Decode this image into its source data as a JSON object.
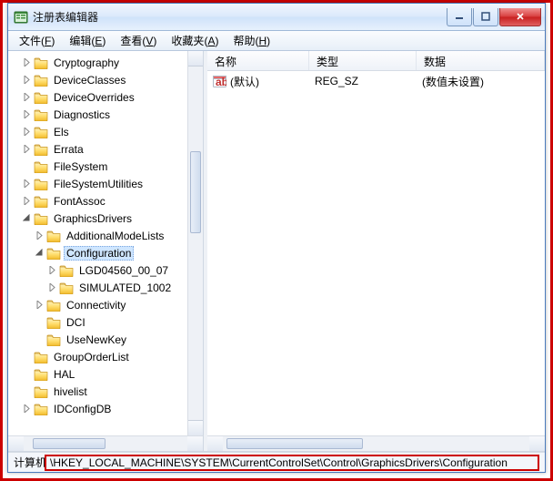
{
  "window": {
    "title": "注册表编辑器"
  },
  "menu": {
    "file": {
      "label": "文件",
      "hotkey": "F"
    },
    "edit": {
      "label": "编辑",
      "hotkey": "E"
    },
    "view": {
      "label": "查看",
      "hotkey": "V"
    },
    "fav": {
      "label": "收藏夹",
      "hotkey": "A"
    },
    "help": {
      "label": "帮助",
      "hotkey": "H"
    }
  },
  "tree": [
    {
      "label": "Cryptography",
      "depth": 0,
      "exp": "closed",
      "selected": false
    },
    {
      "label": "DeviceClasses",
      "depth": 0,
      "exp": "closed",
      "selected": false
    },
    {
      "label": "DeviceOverrides",
      "depth": 0,
      "exp": "closed",
      "selected": false
    },
    {
      "label": "Diagnostics",
      "depth": 0,
      "exp": "closed",
      "selected": false
    },
    {
      "label": "Els",
      "depth": 0,
      "exp": "closed",
      "selected": false
    },
    {
      "label": "Errata",
      "depth": 0,
      "exp": "closed",
      "selected": false
    },
    {
      "label": "FileSystem",
      "depth": 0,
      "exp": "none",
      "selected": false
    },
    {
      "label": "FileSystemUtilities",
      "depth": 0,
      "exp": "closed",
      "selected": false
    },
    {
      "label": "FontAssoc",
      "depth": 0,
      "exp": "closed",
      "selected": false
    },
    {
      "label": "GraphicsDrivers",
      "depth": 0,
      "exp": "open",
      "selected": false
    },
    {
      "label": "AdditionalModeLists",
      "depth": 1,
      "exp": "closed",
      "selected": false
    },
    {
      "label": "Configuration",
      "depth": 1,
      "exp": "open",
      "selected": true
    },
    {
      "label": "LGD04560_00_07",
      "depth": 2,
      "exp": "closed",
      "selected": false
    },
    {
      "label": "SIMULATED_1002",
      "depth": 2,
      "exp": "closed",
      "selected": false
    },
    {
      "label": "Connectivity",
      "depth": 1,
      "exp": "closed",
      "selected": false
    },
    {
      "label": "DCI",
      "depth": 1,
      "exp": "none",
      "selected": false
    },
    {
      "label": "UseNewKey",
      "depth": 1,
      "exp": "none",
      "selected": false
    },
    {
      "label": "GroupOrderList",
      "depth": 0,
      "exp": "none",
      "selected": false
    },
    {
      "label": "HAL",
      "depth": 0,
      "exp": "none",
      "selected": false
    },
    {
      "label": "hivelist",
      "depth": 0,
      "exp": "none",
      "selected": false
    },
    {
      "label": "IDConfigDB",
      "depth": 0,
      "exp": "closed",
      "selected": false
    }
  ],
  "columns": {
    "name": "名称",
    "type": "类型",
    "data": "数据"
  },
  "rows": [
    {
      "name": "(默认)",
      "type": "REG_SZ",
      "data": "(数值未设置)"
    }
  ],
  "status": {
    "prefix": "计算机",
    "path": "\\HKEY_LOCAL_MACHINE\\SYSTEM\\CurrentControlSet\\Control\\GraphicsDrivers\\Configuration"
  }
}
